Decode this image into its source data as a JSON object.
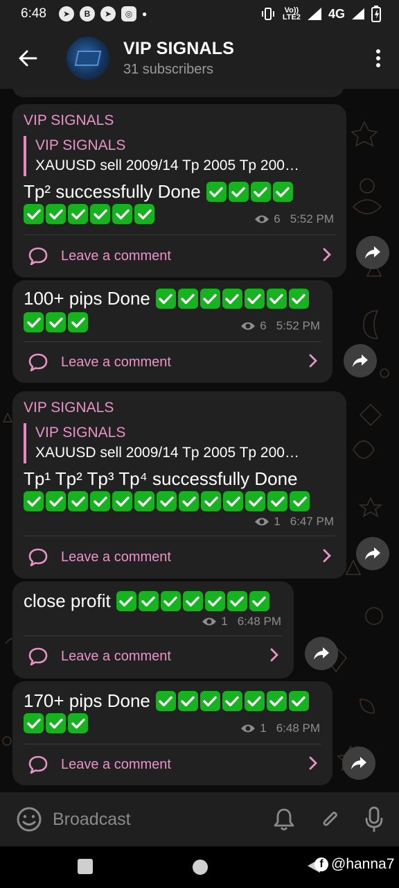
{
  "status_bar": {
    "time": "6:48",
    "notification_icons": [
      "telegram-icon",
      "bitcoin-icon",
      "telegram-icon",
      "instagram-icon"
    ],
    "lte_top": "Vo))",
    "lte_bottom": "LTE2",
    "network": "4G"
  },
  "header": {
    "title": "VIP SIGNALS",
    "subtitle": "31 subscribers"
  },
  "posts": [
    {
      "sender": "VIP SIGNALS",
      "quote_name": "VIP SIGNALS",
      "quote_text": "XAUUSD sell 2009/14 Tp 2005 Tp 200…",
      "message": "Tp² successfully Done",
      "checks_line1": 4,
      "checks_line2": 6,
      "views": "6",
      "time": "5:52 PM",
      "comment_label": "Leave a comment"
    },
    {
      "message": "100+ pips Done",
      "checks_line1": 7,
      "checks_line2": 3,
      "views": "6",
      "time": "5:52 PM",
      "comment_label": "Leave a comment"
    },
    {
      "sender": "VIP SIGNALS",
      "quote_name": "VIP SIGNALS",
      "quote_text": "XAUUSD sell 2009/14 Tp 2005 Tp 200…",
      "message": "Tp¹ Tp² Tp³ Tp⁴ successfully Done",
      "checks_line2": 13,
      "views": "1",
      "time": "6:47 PM",
      "comment_label": "Leave a comment"
    },
    {
      "message": "close profit",
      "checks_line1": 7,
      "views": "1",
      "time": "6:48 PM",
      "comment_label": "Leave a comment"
    },
    {
      "message": "170+ pips Done",
      "checks_line1": 7,
      "checks_line2": 3,
      "views": "1",
      "time": "6:48 PM",
      "comment_label": "Leave a comment"
    }
  ],
  "input_bar": {
    "placeholder": "Broadcast"
  },
  "watermark": "@hanna7",
  "colors": {
    "accent_pink": "#ea93c8",
    "bubble": "#212121",
    "check_green": "#16b21f",
    "bar": "#1f1f1f"
  }
}
